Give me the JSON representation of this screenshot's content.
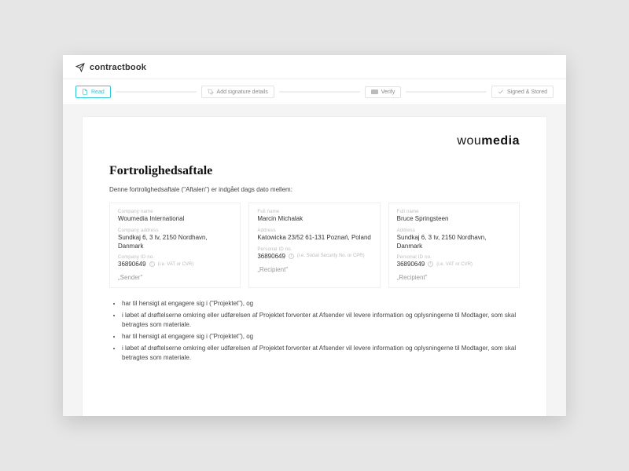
{
  "brand": {
    "name": "contractbook"
  },
  "steps": {
    "read": "Read",
    "add_sig": "Add signature details",
    "verify": "Verify",
    "signed": "Signed & Stored"
  },
  "logo": {
    "prefix": "wou",
    "suffix": "media"
  },
  "doc": {
    "title": "Fortrolighedsaftale",
    "intro": "Denne fortrolighedsaftale (\"Aftalen\") er indgået dags dato mellem:"
  },
  "labels": {
    "company_name": "Company name",
    "company_address": "Company address",
    "company_id": "Company ID no.",
    "full_name": "Full name",
    "address": "Address",
    "personal_id": "Personal ID no.",
    "vat_hint": "(i.e. VAT or CVR)",
    "ssn_hint": "(i.e. Social Security No. or CPR)"
  },
  "parties": [
    {
      "kind": "company",
      "name": "Woumedia International",
      "address": "Sundkaj 6, 3 tv, 2150 Nordhavn, Danmark",
      "id": "36890649",
      "role": "„Sender\""
    },
    {
      "kind": "person",
      "name": "Marcin Michalak",
      "address": "Katowicka 23/52\n61-131 Poznań, Poland",
      "id": "36890649",
      "role": "„Recipient\""
    },
    {
      "kind": "person",
      "name": "Bruce Springsteen",
      "address": "Sundkaj 6, 3 tv, 2150 Nordhavn, Danmark",
      "id": "36890649",
      "role": "„Recipient\""
    }
  ],
  "body": [
    "har til hensigt at engagere sig i (\"Projektet\"), og",
    "i løbet af drøftelserne omkring eller udførelsen af Projektet forventer at Afsender vil levere information og oplysningerne til Modtager, som skal betragtes som  materiale.",
    "har til hensigt at engagere sig i (\"Projektet\"), og",
    "i løbet af drøftelserne omkring eller udførelsen af Projektet forventer at Afsender vil levere information og oplysningerne til Modtager, som skal betragtes som  materiale."
  ]
}
